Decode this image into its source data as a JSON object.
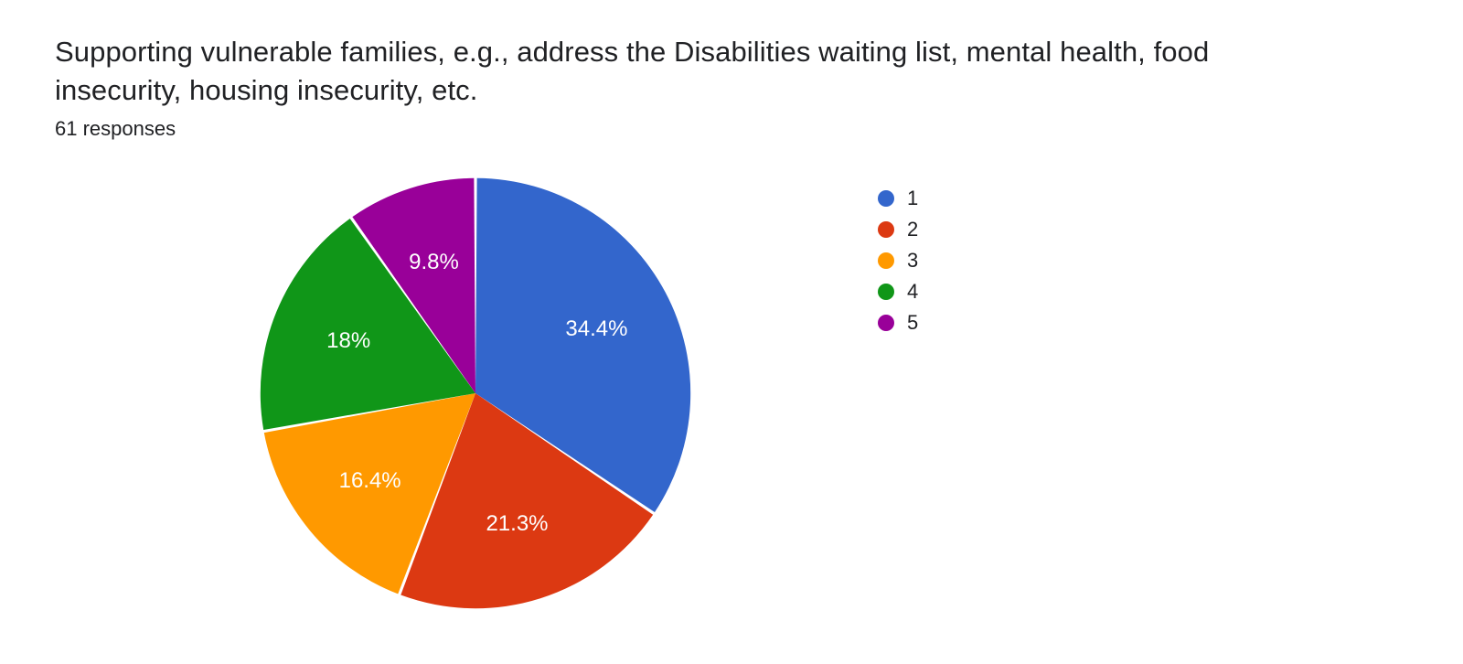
{
  "title": "Supporting vulnerable families, e.g., address the Disabilities waiting list, mental health, food insecurity, housing insecurity, etc.",
  "subtitle": "61 responses",
  "chart_data": {
    "type": "pie",
    "title": "Supporting vulnerable families, e.g., address the Disabilities waiting list, mental health, food insecurity, housing insecurity, etc.",
    "categories": [
      "1",
      "2",
      "3",
      "4",
      "5"
    ],
    "values": [
      34.4,
      21.3,
      16.4,
      18.0,
      9.8
    ],
    "series": [
      {
        "name": "1",
        "value": 34.4,
        "color": "#3366cc",
        "label": "34.4%"
      },
      {
        "name": "2",
        "value": 21.3,
        "color": "#dc3912",
        "label": "21.3%"
      },
      {
        "name": "3",
        "value": 16.4,
        "color": "#ff9900",
        "label": "16.4%"
      },
      {
        "name": "4",
        "value": 18.0,
        "color": "#109618",
        "label": "18%"
      },
      {
        "name": "5",
        "value": 9.8,
        "color": "#990099",
        "label": "9.8%"
      }
    ],
    "start_angle_deg": 0,
    "legend_position": "right"
  }
}
